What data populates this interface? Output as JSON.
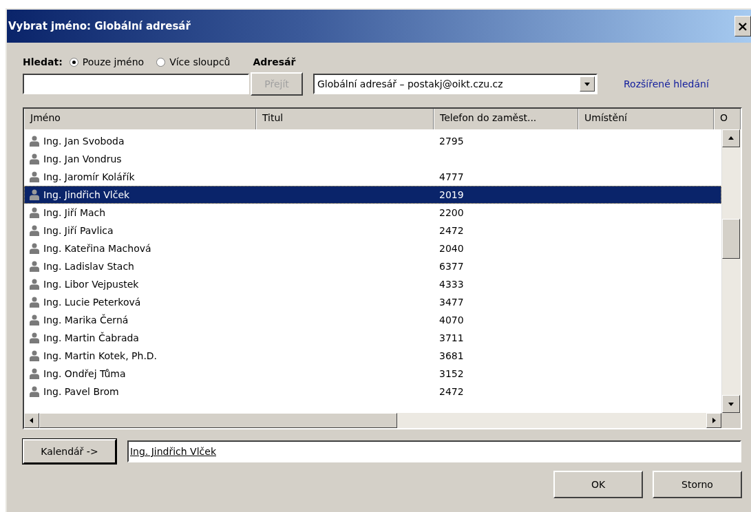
{
  "window": {
    "title": "Vybrat jméno: Globální adresář",
    "close": "×"
  },
  "search": {
    "label": "Hledat:",
    "modes": [
      {
        "label": "Pouze jméno",
        "selected": true
      },
      {
        "label": "Více sloupců",
        "selected": false
      }
    ],
    "go_button": {
      "label": "Přejít",
      "disabled": true
    }
  },
  "address_book": {
    "label": "Adresář",
    "value": "Globální adresář – postakj@oikt.czu.cz",
    "advanced_link": "Rozšířené hledání"
  },
  "table": {
    "columns": [
      "Jméno",
      "Titul",
      "Telefon do zaměst...",
      "Umístění",
      "O"
    ],
    "rows": [
      {
        "name": "Ing. Jan Svoboda",
        "phone": "2795",
        "selected": false
      },
      {
        "name": "Ing. Jan Vondrus",
        "phone": "",
        "selected": false
      },
      {
        "name": "Ing. Jaromír Kolářík",
        "phone": "4777",
        "selected": false
      },
      {
        "name": "Ing. Jindřich Vlček",
        "phone": "2019",
        "selected": true
      },
      {
        "name": "Ing. Jiří Mach",
        "phone": "2200",
        "selected": false
      },
      {
        "name": "Ing. Jiří Pavlica",
        "phone": "2472",
        "selected": false
      },
      {
        "name": "Ing. Kateřina Machová",
        "phone": "2040",
        "selected": false
      },
      {
        "name": "Ing. Ladislav Stach",
        "phone": "6377",
        "selected": false
      },
      {
        "name": "Ing. Libor Vejpustek",
        "phone": "4333",
        "selected": false
      },
      {
        "name": "Ing. Lucie Peterková",
        "phone": "3477",
        "selected": false
      },
      {
        "name": "Ing. Marika Černá",
        "phone": "4070",
        "selected": false
      },
      {
        "name": "Ing. Martin Čabrada",
        "phone": "3711",
        "selected": false
      },
      {
        "name": "Ing. Martin Kotek, Ph.D.",
        "phone": "3681",
        "selected": false
      },
      {
        "name": "Ing. Ondřej Tůma",
        "phone": "3152",
        "selected": false
      },
      {
        "name": "Ing. Pavel Brom",
        "phone": "2472",
        "selected": false
      }
    ]
  },
  "calendar_button": "Kalendář ->",
  "selected_name": "Ing. Jindřich Vlček",
  "buttons": [
    "OK",
    "Storno"
  ]
}
